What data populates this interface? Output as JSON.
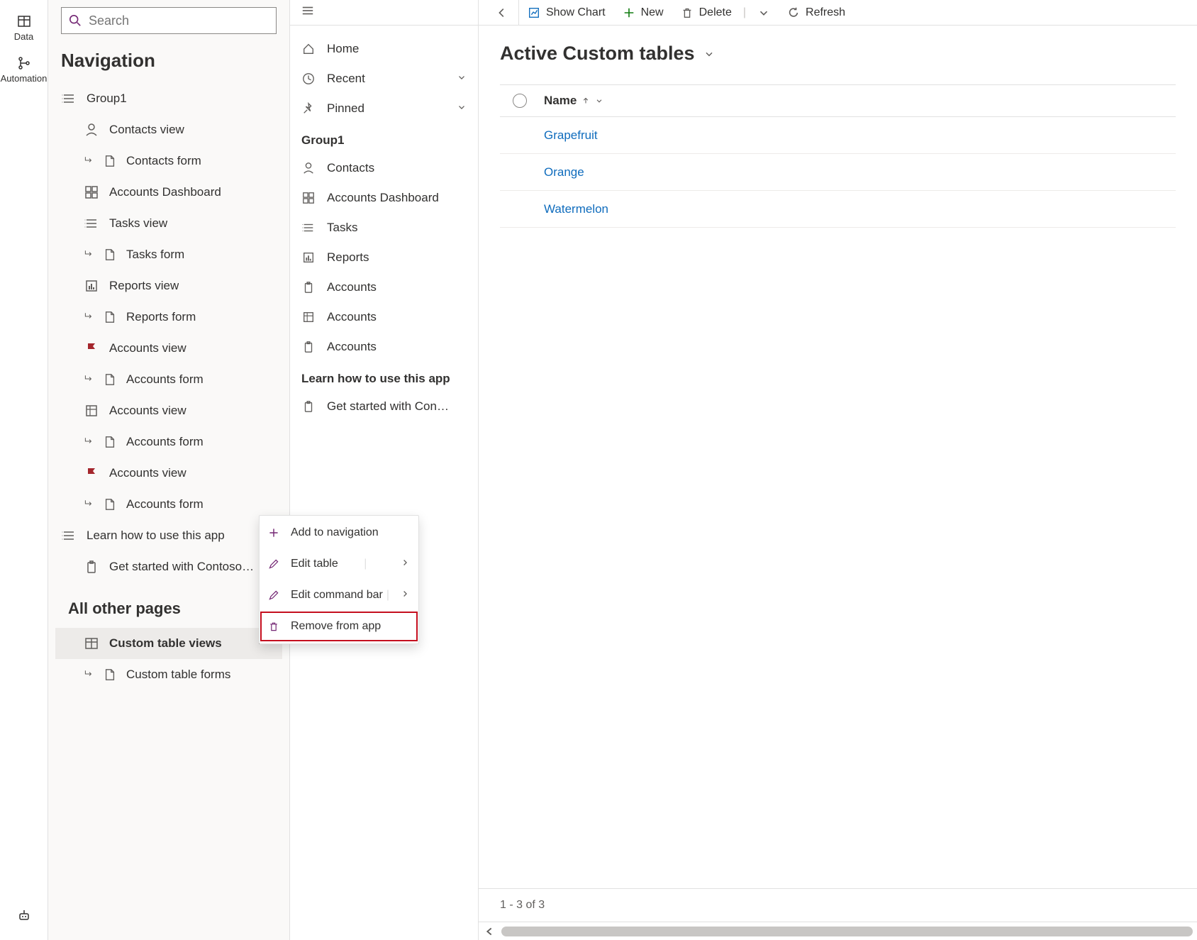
{
  "leftRail": {
    "data": "Data",
    "automation": "Automation"
  },
  "search": {
    "placeholder": "Search"
  },
  "navTitle": "Navigation",
  "navGroup1": {
    "label": "Group1",
    "items": [
      {
        "label": "Contacts view",
        "icon": "person"
      },
      {
        "label": "Contacts form",
        "icon": "form",
        "sub": true
      },
      {
        "label": "Accounts Dashboard",
        "icon": "dashboard"
      },
      {
        "label": "Tasks view",
        "icon": "list"
      },
      {
        "label": "Tasks form",
        "icon": "form",
        "sub": true
      },
      {
        "label": "Reports view",
        "icon": "report"
      },
      {
        "label": "Reports form",
        "icon": "form",
        "sub": true
      },
      {
        "label": "Accounts view",
        "icon": "flag"
      },
      {
        "label": "Accounts form",
        "icon": "form",
        "sub": true
      },
      {
        "label": "Accounts view",
        "icon": "entity"
      },
      {
        "label": "Accounts form",
        "icon": "form",
        "sub": true
      },
      {
        "label": "Accounts view",
        "icon": "flag"
      },
      {
        "label": "Accounts form",
        "icon": "form",
        "sub": true
      }
    ]
  },
  "navLearn": {
    "label": "Learn how to use this app",
    "items": [
      {
        "label": "Get started with Contoso…",
        "icon": "clipboard"
      }
    ]
  },
  "allOther": {
    "title": "All other pages",
    "items": [
      {
        "label": "Custom table views",
        "icon": "table",
        "selected": true
      },
      {
        "label": "Custom table forms",
        "icon": "form",
        "sub": true
      }
    ]
  },
  "sitemap": {
    "top": [
      {
        "label": "Home",
        "icon": "home"
      },
      {
        "label": "Recent",
        "icon": "clock",
        "chevron": true
      },
      {
        "label": "Pinned",
        "icon": "pin",
        "chevron": true
      }
    ],
    "group1Label": "Group1",
    "group1": [
      {
        "label": "Contacts",
        "icon": "person"
      },
      {
        "label": "Accounts Dashboard",
        "icon": "dashboard"
      },
      {
        "label": "Tasks",
        "icon": "list"
      },
      {
        "label": "Reports",
        "icon": "report"
      },
      {
        "label": "Accounts",
        "icon": "clipboard"
      },
      {
        "label": "Accounts",
        "icon": "entity"
      },
      {
        "label": "Accounts",
        "icon": "clipboard"
      }
    ],
    "learnLabel": "Learn how to use this app",
    "learn": [
      {
        "label": "Get started with Con…",
        "icon": "clipboard"
      }
    ]
  },
  "commandBar": {
    "showChart": "Show Chart",
    "new": "New",
    "delete": "Delete",
    "refresh": "Refresh"
  },
  "view": {
    "title": "Active Custom tables",
    "nameCol": "Name",
    "rows": [
      "Grapefruit",
      "Orange",
      "Watermelon"
    ],
    "pager": "1 - 3 of 3"
  },
  "contextMenu": {
    "addNav": "Add to navigation",
    "editTable": "Edit table",
    "editCmd": "Edit command bar",
    "remove": "Remove from app"
  }
}
